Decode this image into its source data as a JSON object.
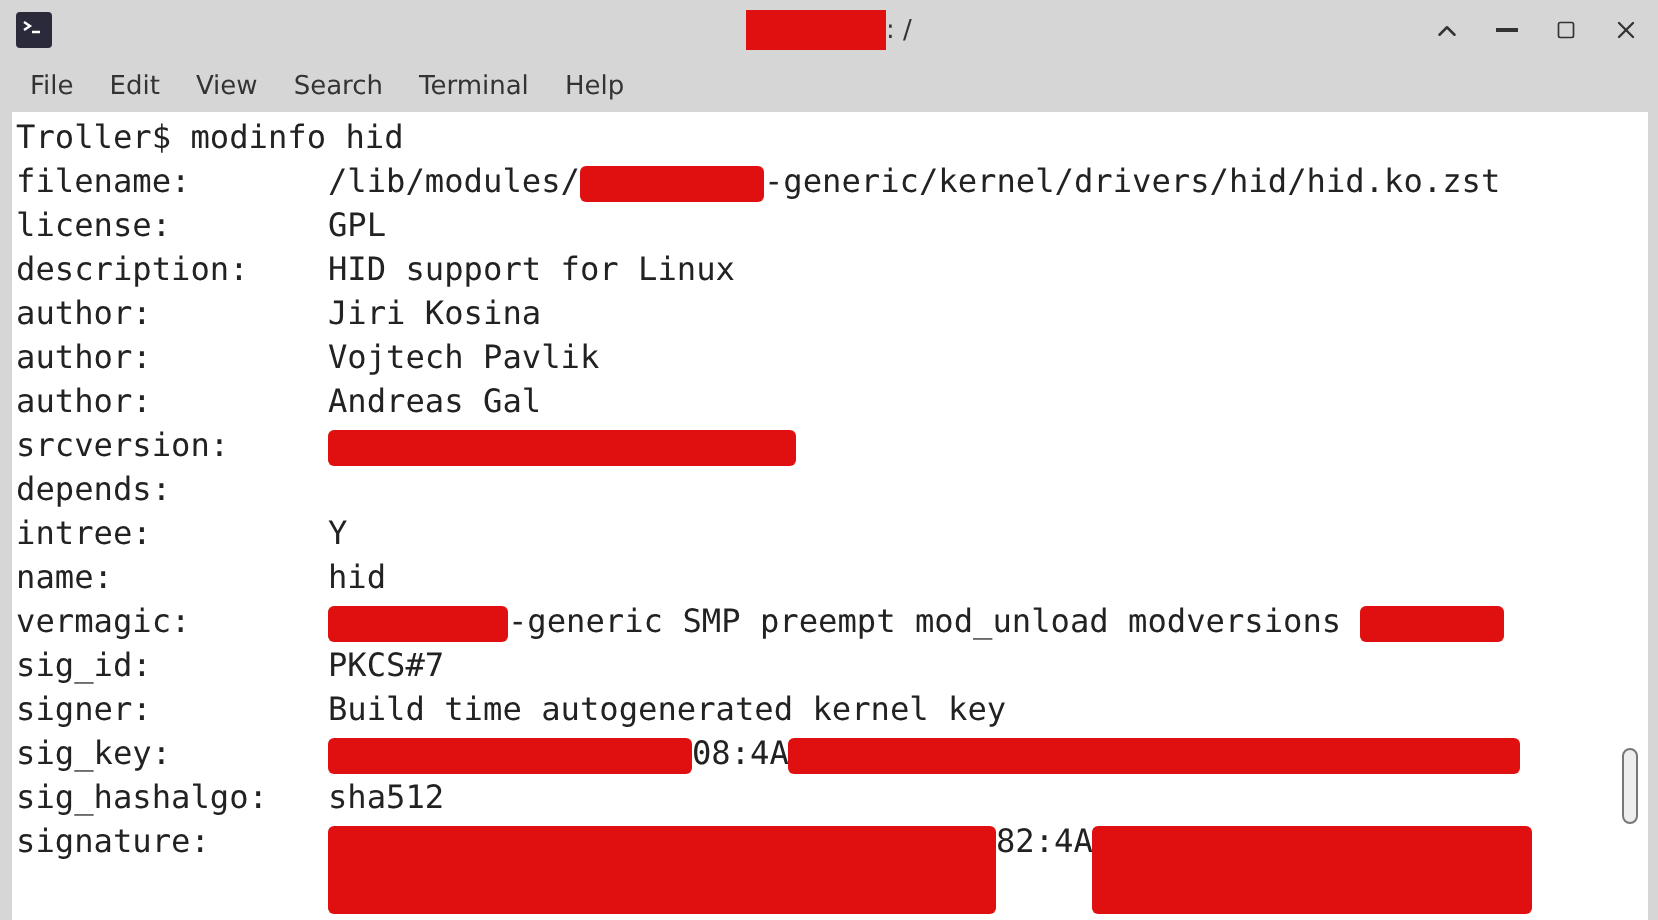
{
  "window": {
    "title_parts": [
      {
        "kind": "redacted"
      },
      {
        "kind": "text",
        "text": ": /"
      }
    ]
  },
  "menu": [
    "File",
    "Edit",
    "View",
    "Search",
    "Terminal",
    "Help"
  ],
  "prompt": "Troller$ modinfo hid",
  "lines": [
    {
      "key": "filename:",
      "parts": [
        {
          "kind": "text",
          "text": "/lib/modules/"
        },
        {
          "kind": "redacted"
        },
        {
          "kind": "text",
          "text": "-generic/kernel/drivers/hid/hid.ko.zst"
        }
      ]
    },
    {
      "key": "license:",
      "parts": [
        {
          "kind": "text",
          "text": "GPL"
        }
      ]
    },
    {
      "key": "description:",
      "parts": [
        {
          "kind": "text",
          "text": "HID support for Linux"
        }
      ]
    },
    {
      "key": "author:",
      "parts": [
        {
          "kind": "text",
          "text": "Jiri Kosina"
        }
      ]
    },
    {
      "key": "author:",
      "parts": [
        {
          "kind": "text",
          "text": "Vojtech Pavlik"
        }
      ]
    },
    {
      "key": "author:",
      "parts": [
        {
          "kind": "text",
          "text": "Andreas Gal"
        }
      ]
    },
    {
      "key": "srcversion:",
      "parts": [
        {
          "kind": "redacted"
        }
      ]
    },
    {
      "key": "depends:"
    },
    {
      "key": "intree:",
      "parts": [
        {
          "kind": "text",
          "text": "Y"
        }
      ]
    },
    {
      "key": "name:",
      "parts": [
        {
          "kind": "text",
          "text": "hid"
        }
      ]
    },
    {
      "key": "vermagic:",
      "parts": [
        {
          "kind": "redacted"
        },
        {
          "kind": "text",
          "text": "-generic SMP preempt mod_unload modversions "
        },
        {
          "kind": "redacted"
        }
      ]
    },
    {
      "key": "sig_id:",
      "parts": [
        {
          "kind": "text",
          "text": "PKCS#7"
        }
      ]
    },
    {
      "key": "signer:",
      "parts": [
        {
          "kind": "text",
          "text": "Build time autogenerated kernel key"
        }
      ]
    },
    {
      "key": "sig_key:",
      "parts": [
        {
          "kind": "redacted"
        },
        {
          "kind": "text",
          "text": "08:4A"
        },
        {
          "kind": "redacted"
        }
      ]
    },
    {
      "key": "sig_hashalgo:",
      "parts": [
        {
          "kind": "text",
          "text": "sha512"
        }
      ]
    },
    {
      "key": "signature:",
      "parts": [
        {
          "kind": "redacted"
        },
        {
          "kind": "text",
          "text": "82:4A"
        },
        {
          "kind": "redacted"
        }
      ]
    }
  ]
}
